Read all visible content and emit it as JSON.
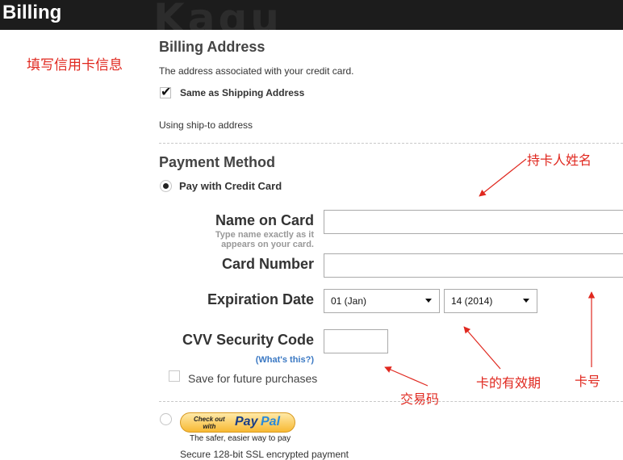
{
  "header": {
    "title": "Billing",
    "watermark": "Kaqu"
  },
  "annotations": {
    "fill_card_info": "填写信用卡信息",
    "cardholder_name": "持卡人姓名",
    "expiry_date": "卡的有效期",
    "card_number": "卡号",
    "security_code": "交易码"
  },
  "billing_address": {
    "heading": "Billing Address",
    "description": "The address associated with your credit card.",
    "same_as_shipping_label": "Same as Shipping Address",
    "same_as_shipping_checked": true,
    "status": "Using ship-to address"
  },
  "payment_method": {
    "heading": "Payment Method",
    "credit_card_option": "Pay with Credit Card",
    "credit_card_selected": true
  },
  "form": {
    "name_label": "Name on Card",
    "name_hint_line1": "Type name exactly as it",
    "name_hint_line2": "appears on your card.",
    "name_value": "",
    "card_number_label": "Card Number",
    "card_number_value": "",
    "expiration_label": "Expiration Date",
    "expiration_month": "01 (Jan)",
    "expiration_year": "14 (2014)",
    "cvv_label": "CVV Security Code",
    "cvv_help_link": "(What's this?)",
    "cvv_value": "",
    "save_label": "Save for future purchases",
    "save_checked": false
  },
  "paypal": {
    "button_checkout": "Check out",
    "button_with": "with",
    "brand_pay": "Pay",
    "brand_pal": "Pal",
    "tagline": "The safer, easier way to pay",
    "secure_note": "Secure 128-bit SSL encrypted payment"
  },
  "colors": {
    "annotation": "#e0281f",
    "header_bg": "#1c1c1c",
    "link": "#3a78c3"
  }
}
